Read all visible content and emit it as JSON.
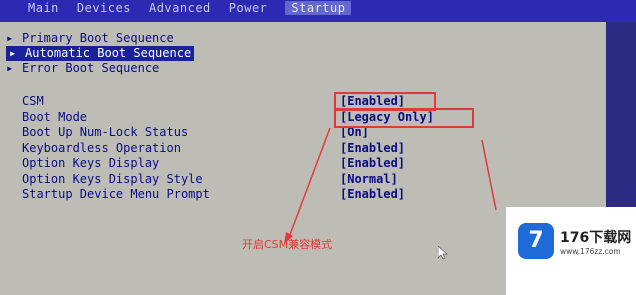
{
  "topbar": {
    "tabs": [
      {
        "label": "Main"
      },
      {
        "label": "Devices"
      },
      {
        "label": "Advanced"
      },
      {
        "label": "Power"
      },
      {
        "label": "Startup"
      }
    ]
  },
  "menu": {
    "items": [
      {
        "label": "Primary Boot Sequence"
      },
      {
        "label": "Automatic Boot Sequence"
      },
      {
        "label": "Error Boot Sequence"
      }
    ]
  },
  "settings": {
    "labels": [
      "CSM",
      "Boot Mode",
      "Boot Up Num-Lock Status",
      "Keyboardless Operation",
      "Option Keys Display",
      "Option Keys Display Style",
      "Startup Device Menu Prompt"
    ],
    "values": [
      "[Enabled]",
      "[Legacy Only]",
      "[On]",
      "[Enabled]",
      "[Enabled]",
      "[Normal]",
      "[Enabled]"
    ]
  },
  "annotation": "开启CSM兼容模式",
  "brand": {
    "logo_text": "7",
    "name": "176下载网",
    "url": "www.176zz.com"
  },
  "colors": {
    "bios_blue": "#0a0b86",
    "screen_bg": "#bdbdb5",
    "annotation_red": "#e23a3a",
    "highlight": "#19229b"
  }
}
